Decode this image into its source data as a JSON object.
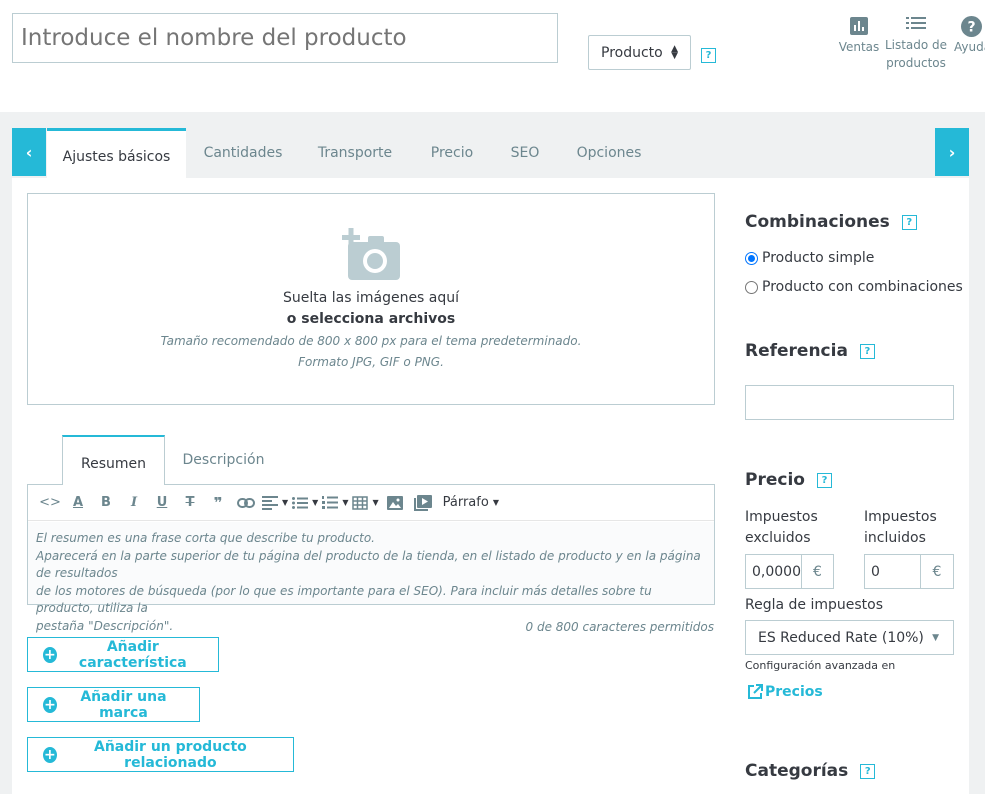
{
  "header": {
    "name_placeholder": "Introduce el nombre del producto",
    "type_select": "Producto",
    "help": "?",
    "quick_links": [
      {
        "label": "Ventas",
        "icon": "bar-chart-icon"
      },
      {
        "label": "Listado de productos",
        "icon": "list-icon"
      },
      {
        "label": "Ayuda",
        "icon": "help-icon"
      }
    ]
  },
  "tabs": [
    "Ajustes básicos",
    "Cantidades",
    "Transporte",
    "Precio",
    "SEO",
    "Opciones"
  ],
  "dropzone": {
    "line1": "Suelta las imágenes aquí",
    "line2": "o selecciona archivos",
    "line3": "Tamaño recomendado de 800 x 800 px para el tema predeterminado.",
    "line4": "Formato JPG, GIF o PNG."
  },
  "editor": {
    "tabs": [
      "Resumen",
      "Descripción"
    ],
    "paragraph_label": "Párrafo",
    "placeholder_lines": [
      "El resumen es una frase corta que describe tu producto.",
      "Aparecerá en la parte superior de tu página del producto de la tienda, en el listado de producto y en la página de resultados",
      "de los motores de búsqueda (por lo que es importante para el SEO). Para incluir más detalles sobre tu producto, utiliza la",
      "pestaña \"Descripción\"."
    ],
    "counter": "0 de 800 caracteres permitidos"
  },
  "actions": [
    "Añadir característica",
    "Añadir una marca",
    "Añadir un producto relacionado"
  ],
  "combinations": {
    "title": "Combinaciones",
    "options": [
      "Producto simple",
      "Producto con combinaciones"
    ],
    "selected": "Producto simple"
  },
  "reference": {
    "title": "Referencia",
    "value": ""
  },
  "price": {
    "title": "Precio",
    "excl_label_1": "Impuestos",
    "excl_label_2": "excluidos",
    "incl_label_1": "Impuestos",
    "incl_label_2": "incluidos",
    "excl_value": "0,0000",
    "incl_value": "0",
    "currency": "€",
    "tax_rule_label": "Regla de impuestos",
    "tax_rule": "ES Reduced Rate (10%)",
    "advanced_text": "Configuración avanzada en",
    "advanced_link": "Precios"
  },
  "categories": {
    "title": "Categorías"
  },
  "colors": {
    "accent": "#25b9d7",
    "text": "#363a41",
    "muted": "#6c868e",
    "border": "#bbcdd2",
    "bg": "#eff1f2"
  }
}
